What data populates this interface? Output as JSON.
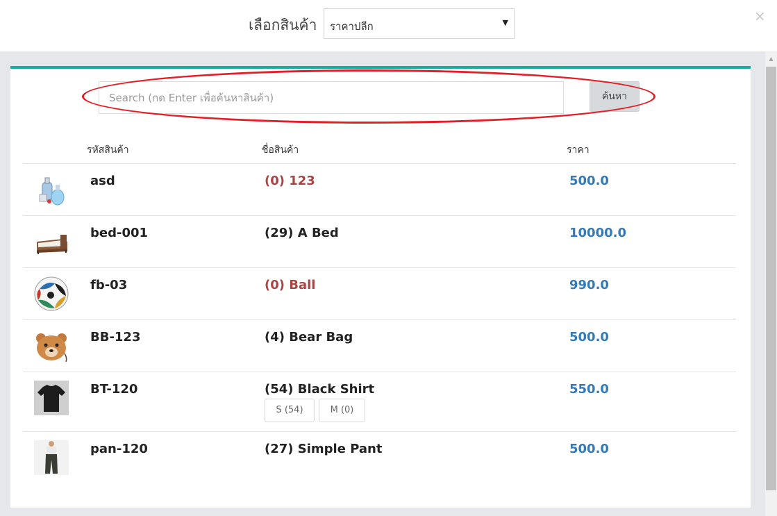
{
  "header": {
    "label": "เลือกสินค้า",
    "price_type_select": {
      "selected": "ราคาปลีก"
    },
    "close_symbol": "×"
  },
  "search": {
    "placeholder": "Search (กด Enter เพื่อค้นหาสินค้า)",
    "button_label": "ค้นหา"
  },
  "table": {
    "columns": [
      "รหัสสินค้า",
      "ชื่อสินค้า",
      "ราคา"
    ],
    "rows": [
      {
        "image": "spray-bottles",
        "code": "asd",
        "name": "(0) 123",
        "price": "500.0",
        "out_of_stock": true
      },
      {
        "image": "bed",
        "code": "bed-001",
        "name": "(29) A Bed",
        "price": "10000.0",
        "out_of_stock": false
      },
      {
        "image": "football",
        "code": "fb-03",
        "name": "(0) Ball",
        "price": "990.0",
        "out_of_stock": true
      },
      {
        "image": "bear-bag",
        "code": "BB-123",
        "name": "(4) Bear Bag",
        "price": "500.0",
        "out_of_stock": false
      },
      {
        "image": "black-shirt",
        "code": "BT-120",
        "name": "(54) Black Shirt",
        "price": "550.0",
        "out_of_stock": false,
        "variants": [
          "S (54)",
          "M (0)"
        ]
      },
      {
        "image": "pants",
        "code": "pan-120",
        "name": "(27) Simple Pant",
        "price": "500.0",
        "out_of_stock": false
      }
    ]
  },
  "colors": {
    "accent": "#1aab9b",
    "price": "#337ab7",
    "out_of_stock": "#a94442",
    "highlight": "#e31e24"
  }
}
